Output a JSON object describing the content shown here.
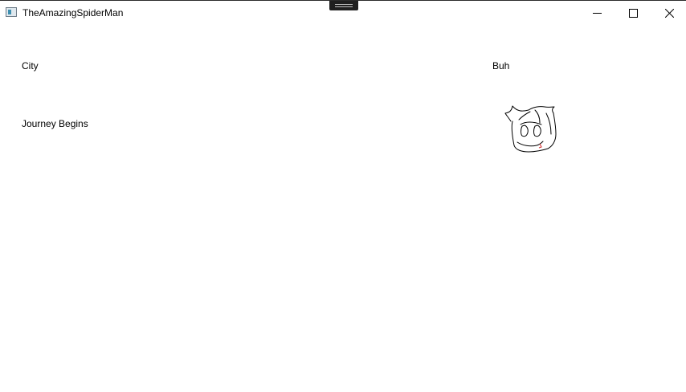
{
  "window": {
    "title": "TheAmazingSpiderMan",
    "app_icon": "app-window-icon",
    "controls": {
      "minimize_icon": "minimize-icon",
      "maximize_icon": "maximize-icon",
      "close_icon": "close-icon"
    }
  },
  "content": {
    "left_labels": {
      "city": "City",
      "journey": "Journey Begins"
    },
    "right_label": "Buh",
    "drawing": "spiderman-face-doodle"
  },
  "colors": {
    "background": "#ffffff",
    "text": "#000000",
    "drag_handle": "#1f1f1f",
    "doodle_accent": "#d62828"
  }
}
